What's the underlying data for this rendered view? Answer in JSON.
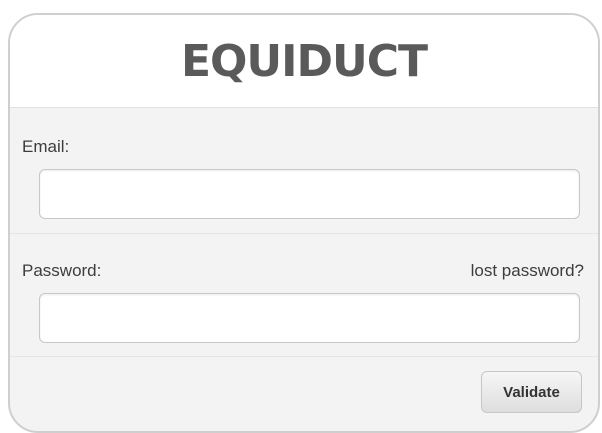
{
  "header": {
    "title": "EQUIDUCT"
  },
  "form": {
    "email_label": "Email:",
    "email_value": "",
    "password_label": "Password:",
    "password_value": "",
    "lost_password_link": "lost password?",
    "submit_label": "Validate"
  }
}
